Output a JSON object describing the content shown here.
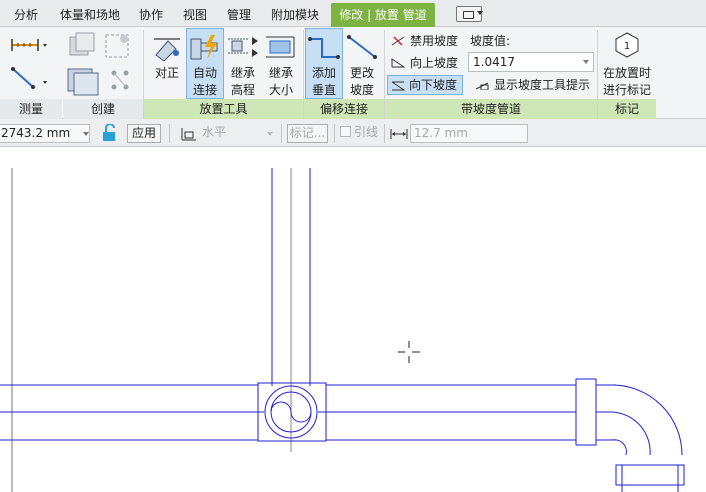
{
  "tabs": [
    {
      "label": "分析"
    },
    {
      "label": "体量和场地"
    },
    {
      "label": "协作"
    },
    {
      "label": "视图"
    },
    {
      "label": "管理"
    },
    {
      "label": "附加模块"
    },
    {
      "label": "修改 | 放置 管道"
    }
  ],
  "ribbon": {
    "panels": {
      "measure": "测量",
      "create": "创建",
      "placement_tools": "放置工具",
      "offset_connect": "偏移连接",
      "sloped_pipe": "带坡度管道",
      "tag": "标记"
    },
    "buttons": {
      "align": "对正",
      "auto_connect_1": "自动",
      "auto_connect_2": "连接",
      "inherit_elev_1": "继承",
      "inherit_elev_2": "高程",
      "inherit_size_1": "继承",
      "inherit_size_2": "大小",
      "add_vertical_1": "添加",
      "add_vertical_2": "垂直",
      "change_slope_1": "更改",
      "change_slope_2": "坡度",
      "tag_on_place_1": "在放置时",
      "tag_on_place_2": "进行标记"
    },
    "slope": {
      "disable": "禁用坡度",
      "up": "向上坡度",
      "down": "向下坡度",
      "show_tooltip": "显示坡度工具提示",
      "value_label": "坡度值:",
      "value": "1.0417"
    },
    "tag_number": "1"
  },
  "options_bar": {
    "offset_value": "2743.2 mm",
    "apply": "应用",
    "justification": "水平",
    "tag_button": "标记...",
    "leader_label": "引线",
    "leader_length": "12.7 mm"
  },
  "colors": {
    "active_tab": "#7cb342",
    "pipe_line": "#1f1fd0",
    "selected_button": "#c6dff3"
  }
}
